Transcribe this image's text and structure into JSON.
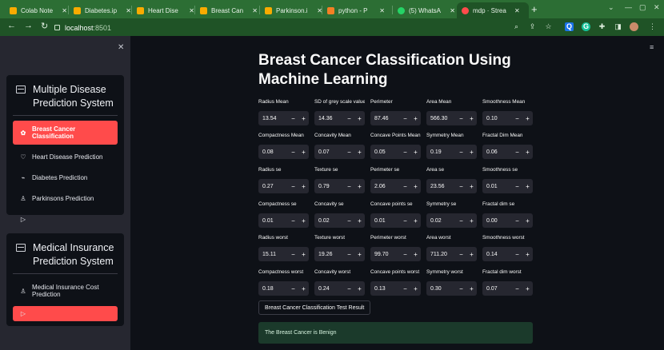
{
  "browser": {
    "tabs": [
      {
        "label": "Colab Note",
        "icon": "colab-icon",
        "color": "#f9ab00"
      },
      {
        "label": "Diabetes.ip",
        "icon": "colab-icon",
        "color": "#f9ab00"
      },
      {
        "label": "Heart Dise",
        "icon": "colab-icon",
        "color": "#f9ab00"
      },
      {
        "label": "Breast Can",
        "icon": "colab-icon",
        "color": "#f9ab00"
      },
      {
        "label": "Parkinson.i",
        "icon": "colab-icon",
        "color": "#f9ab00"
      },
      {
        "label": "python - P",
        "icon": "stackoverflow-icon",
        "color": "#f48024"
      },
      {
        "label": "(5) WhatsA",
        "icon": "whatsapp-icon",
        "color": "#25d366"
      },
      {
        "label": "mdp · Strea",
        "icon": "streamlit-icon",
        "color": "#ff4b4b",
        "active": true
      }
    ],
    "close_glyph": "✕",
    "new_tab": "+",
    "url_host": "localhost",
    "url_port": ":8501"
  },
  "sidebar": {
    "close": "✕",
    "disease_menu": {
      "title": "Multiple Disease Prediction System",
      "items": [
        {
          "label": "Breast Cancer Classification",
          "icon": "ribbon-icon",
          "active": true
        },
        {
          "label": "Heart Disease Prediction",
          "icon": "heart-icon"
        },
        {
          "label": "Diabetes Prediction",
          "icon": "activity-icon"
        },
        {
          "label": "Parkinsons Prediction",
          "icon": "person-icon"
        },
        {
          "label": "",
          "icon": "play-icon"
        }
      ]
    },
    "insurance_menu": {
      "title": "Medical Insurance Prediction System",
      "items": [
        {
          "label": "Medical Insurance Cost Prediction",
          "icon": "person-icon"
        },
        {
          "label": "",
          "icon": "play-icon",
          "active": true
        }
      ]
    }
  },
  "main": {
    "title": "Breast Cancer Classification Using Machine Learning",
    "fields": [
      {
        "label": "Radius Mean",
        "value": "13.54"
      },
      {
        "label": "SD of grey scale value",
        "value": "14.36"
      },
      {
        "label": "Perimeter",
        "value": "87.46"
      },
      {
        "label": "Area Mean",
        "value": "566.30"
      },
      {
        "label": "Smoothness Mean",
        "value": "0.10"
      },
      {
        "label": "Compactness Mean",
        "value": "0.08"
      },
      {
        "label": "Concavity Mean",
        "value": "0.07"
      },
      {
        "label": "Concave Points Mean",
        "value": "0.05"
      },
      {
        "label": "Symmetry Mean",
        "value": "0.19"
      },
      {
        "label": "Fractal Dim Mean",
        "value": "0.06"
      },
      {
        "label": "Radius se",
        "value": "0.27"
      },
      {
        "label": "Texture se",
        "value": "0.79"
      },
      {
        "label": "Perimeter se",
        "value": "2.06"
      },
      {
        "label": "Area se",
        "value": "23.56"
      },
      {
        "label": "Smoothness se",
        "value": "0.01"
      },
      {
        "label": "Compactness se",
        "value": "0.01"
      },
      {
        "label": "Concavity se",
        "value": "0.02"
      },
      {
        "label": "Concave points se",
        "value": "0.01"
      },
      {
        "label": "Symmetry se",
        "value": "0.02"
      },
      {
        "label": "Fractal dim se",
        "value": "0.00"
      },
      {
        "label": "Radius worst",
        "value": "15.11"
      },
      {
        "label": "Texture worst",
        "value": "19.26"
      },
      {
        "label": "Perimeter worst",
        "value": "99.70"
      },
      {
        "label": "Area worst",
        "value": "711.20"
      },
      {
        "label": "Smoothness worst",
        "value": "0.14"
      },
      {
        "label": "Compactness worst",
        "value": "0.18"
      },
      {
        "label": "Concavity worst",
        "value": "0.24"
      },
      {
        "label": "Concave points worst",
        "value": "0.13"
      },
      {
        "label": "Symmetry worst",
        "value": "0.30"
      },
      {
        "label": "Fractal dim worst",
        "value": "0.07"
      }
    ],
    "minus": "−",
    "plus": "+",
    "result_button": "Breast Cancer Classification Test Result",
    "result_message": "The Breast Cancer is Benign"
  },
  "colors": {
    "accent": "#ff4b4b",
    "background": "#0e1117",
    "sidebar": "#262730",
    "success_bg": "#1b3a2b",
    "browser_chrome": "#2c6e34"
  }
}
